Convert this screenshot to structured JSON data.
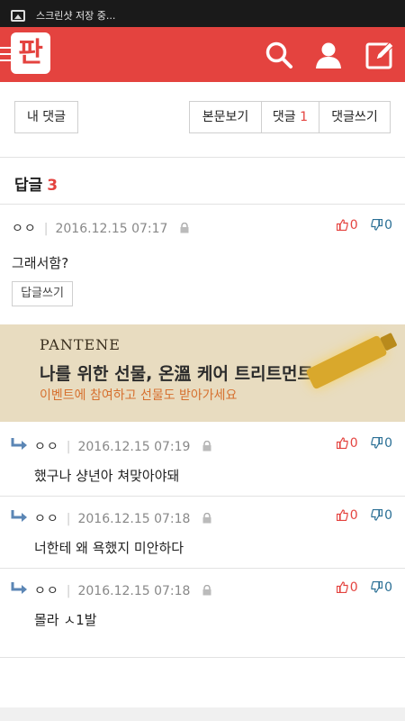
{
  "status_bar": {
    "notification": "스크린샷 저장 중..."
  },
  "header": {
    "logo": "판",
    "accent": "#e4433f"
  },
  "subnav": {
    "my_comments": "내 댓글",
    "view_post": "본문보기",
    "comments_label": "댓글",
    "comments_count": "1",
    "write_comment": "댓글쓰기"
  },
  "replies": {
    "label": "답글",
    "count": "3"
  },
  "main_comment": {
    "nick": "ㅇㅇ",
    "date": "2016.12.15 07:17",
    "up": "0",
    "down": "0",
    "text": "그래서함?",
    "reply_button": "답글쓰기"
  },
  "ad": {
    "brand": "PANTENE",
    "headline": "나를 위한 선물, 온溫 케어 트리트먼트",
    "sub": "이벤트에 참여하고 선물도 받아가세요"
  },
  "reply_items": [
    {
      "nick": "ㅇㅇ",
      "date": "2016.12.15 07:19",
      "up": "0",
      "down": "0",
      "text": "했구나 샹년아 쳐맞아야돼"
    },
    {
      "nick": "ㅇㅇ",
      "date": "2016.12.15 07:18",
      "up": "0",
      "down": "0",
      "text": "너한테 왜 욕했지 미안하다"
    },
    {
      "nick": "ㅇㅇ",
      "date": "2016.12.15 07:18",
      "up": "0",
      "down": "0",
      "text": "몰라 ㅅ1발"
    }
  ],
  "icons": {
    "menu": "hamburger-icon",
    "search": "search-icon",
    "user": "user-icon",
    "edit": "edit-icon",
    "lock": "lock-icon",
    "thumbs_up": "thumbs-up-icon",
    "thumbs_down": "thumbs-down-icon",
    "reply_arrow": "reply-arrow-icon"
  }
}
